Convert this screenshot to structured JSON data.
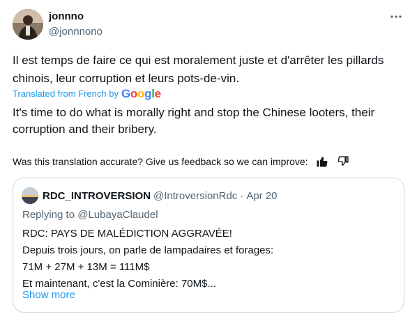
{
  "author": {
    "name": "jonnno",
    "handle": "@jonnnono",
    "avatar": "avatar-photo",
    "more_icon": "more-dots-icon"
  },
  "tweet": {
    "text_original": "Il est temps de faire ce qui est moralement juste et d'arrêter les pillards chinois, leur corruption et leurs pots-de-vin.",
    "translated_from": "Translated from French by",
    "google_logo": "Google",
    "text_translated": "It's time to do what is morally right and stop the Chinese looters, their corruption and their bribery."
  },
  "feedback": {
    "prompt": "Was this translation accurate? Give us feedback so we can improve:",
    "thumbs_up_icon": "thumbs-up-icon",
    "thumbs_down_icon": "thumbs-down-icon"
  },
  "quoted": {
    "name": "RDC_INTROVERSION",
    "handle": "@IntroversionRdc",
    "separator": "·",
    "date": "Apr 20",
    "replying_prefix": "Replying to",
    "replying_to": "@LubayaClaudel",
    "lines": [
      "RDC: PAYS DE MALÉDICTION AGGRAVÉE!",
      "Depuis trois jours, on parle de lampadaires et forages:",
      "71M + 27M + 13M = 111M$",
      "Et maintenant, c'est la Cominière: 70M$..."
    ],
    "show_more": "Show more"
  },
  "colors": {
    "text": "#0f1419",
    "secondary": "#536471",
    "link": "#1d9bf0",
    "border": "#cfd9de"
  }
}
